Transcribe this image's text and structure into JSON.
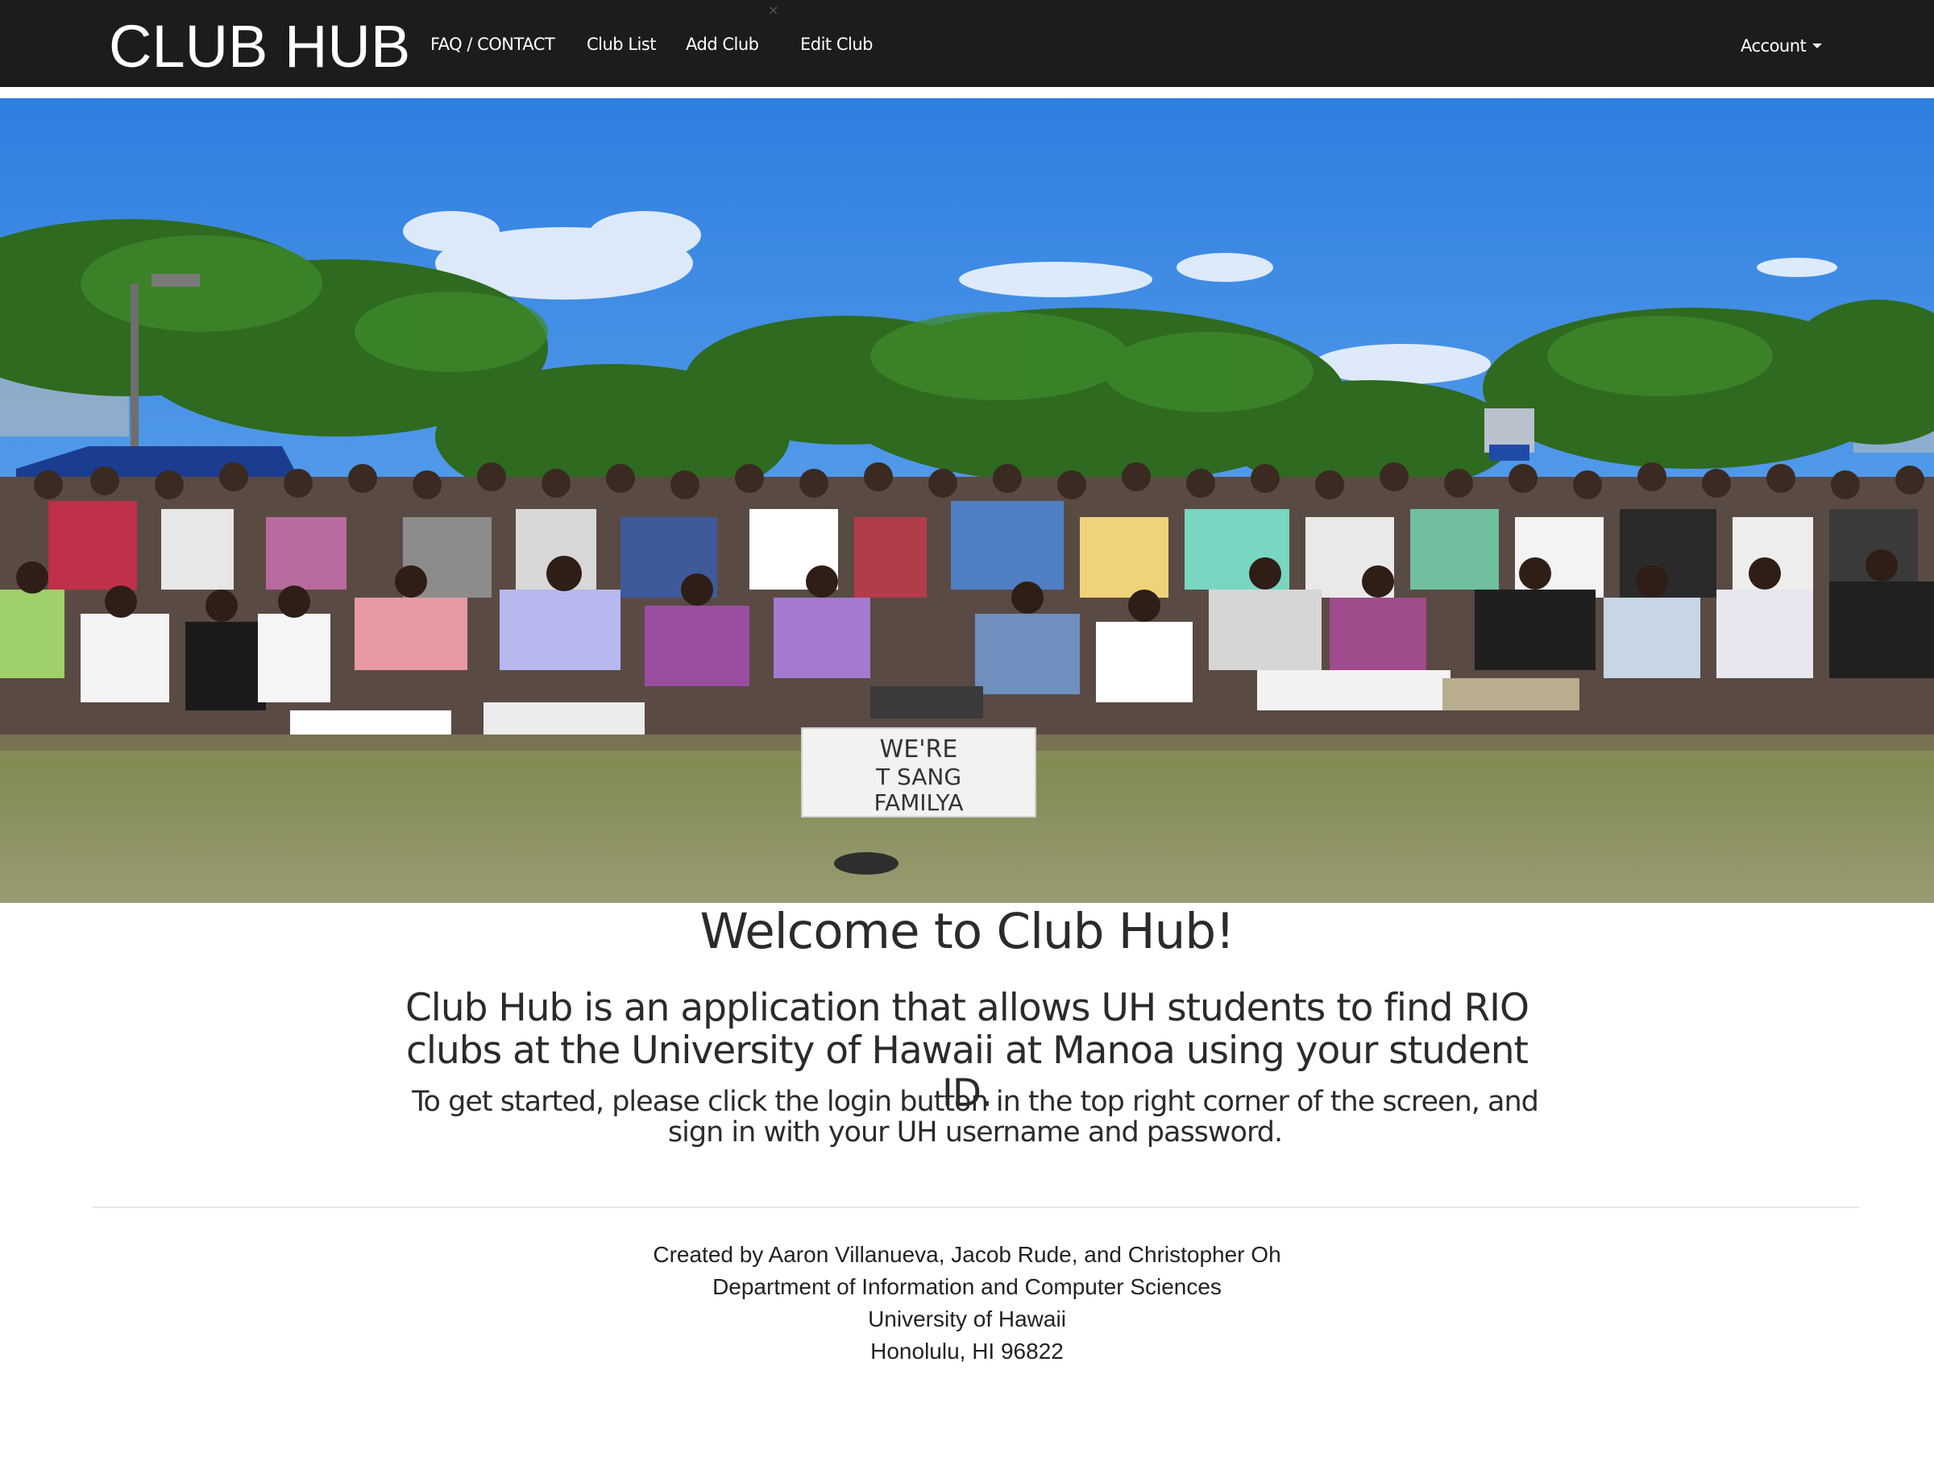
{
  "navbar": {
    "brand": "CLUB HUB",
    "links": [
      {
        "label": "FAQ / CONTACT"
      },
      {
        "label": "Club List"
      },
      {
        "label": "Add Club"
      },
      {
        "label": "Edit Club"
      }
    ],
    "close_glyph": "×",
    "account_label": "Account",
    "account_icon": "caret-down-icon"
  },
  "hero": {
    "image": "group-photo-club-members-park",
    "sign_text": [
      "WE'RE",
      "T SANG",
      "FAMILYA"
    ]
  },
  "main": {
    "heading": "Welcome to Club Hub!",
    "lead": "Club Hub is an application that allows UH students to find RIO clubs at the University of Hawaii at Manoa using your student ID.",
    "instructions": "To get started, please click the login button in the top right corner of the screen, and sign in with your UH username and password."
  },
  "footer": {
    "lines": [
      "Created by Aaron Villanueva, Jacob Rude, and Christopher Oh",
      "Department of Information and Computer Sciences",
      "University of Hawaii",
      "Honolulu, HI 96822"
    ]
  },
  "colors": {
    "navbar_bg": "#1b1c1d",
    "text": "#2b2b2b",
    "sky": "#3f86e0",
    "grass": "#8a8f5a"
  }
}
